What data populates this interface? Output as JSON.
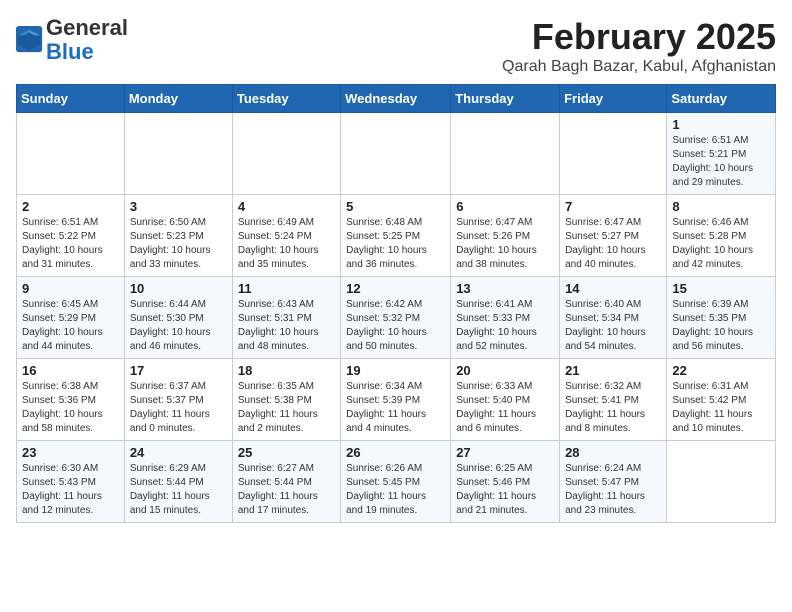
{
  "header": {
    "logo_line1": "General",
    "logo_line2": "Blue",
    "month_title": "February 2025",
    "location": "Qarah Bagh Bazar, Kabul, Afghanistan"
  },
  "days_of_week": [
    "Sunday",
    "Monday",
    "Tuesday",
    "Wednesday",
    "Thursday",
    "Friday",
    "Saturday"
  ],
  "weeks": [
    [
      {
        "day": "",
        "info": ""
      },
      {
        "day": "",
        "info": ""
      },
      {
        "day": "",
        "info": ""
      },
      {
        "day": "",
        "info": ""
      },
      {
        "day": "",
        "info": ""
      },
      {
        "day": "",
        "info": ""
      },
      {
        "day": "1",
        "info": "Sunrise: 6:51 AM\nSunset: 5:21 PM\nDaylight: 10 hours and 29 minutes."
      }
    ],
    [
      {
        "day": "2",
        "info": "Sunrise: 6:51 AM\nSunset: 5:22 PM\nDaylight: 10 hours and 31 minutes."
      },
      {
        "day": "3",
        "info": "Sunrise: 6:50 AM\nSunset: 5:23 PM\nDaylight: 10 hours and 33 minutes."
      },
      {
        "day": "4",
        "info": "Sunrise: 6:49 AM\nSunset: 5:24 PM\nDaylight: 10 hours and 35 minutes."
      },
      {
        "day": "5",
        "info": "Sunrise: 6:48 AM\nSunset: 5:25 PM\nDaylight: 10 hours and 36 minutes."
      },
      {
        "day": "6",
        "info": "Sunrise: 6:47 AM\nSunset: 5:26 PM\nDaylight: 10 hours and 38 minutes."
      },
      {
        "day": "7",
        "info": "Sunrise: 6:47 AM\nSunset: 5:27 PM\nDaylight: 10 hours and 40 minutes."
      },
      {
        "day": "8",
        "info": "Sunrise: 6:46 AM\nSunset: 5:28 PM\nDaylight: 10 hours and 42 minutes."
      }
    ],
    [
      {
        "day": "9",
        "info": "Sunrise: 6:45 AM\nSunset: 5:29 PM\nDaylight: 10 hours and 44 minutes."
      },
      {
        "day": "10",
        "info": "Sunrise: 6:44 AM\nSunset: 5:30 PM\nDaylight: 10 hours and 46 minutes."
      },
      {
        "day": "11",
        "info": "Sunrise: 6:43 AM\nSunset: 5:31 PM\nDaylight: 10 hours and 48 minutes."
      },
      {
        "day": "12",
        "info": "Sunrise: 6:42 AM\nSunset: 5:32 PM\nDaylight: 10 hours and 50 minutes."
      },
      {
        "day": "13",
        "info": "Sunrise: 6:41 AM\nSunset: 5:33 PM\nDaylight: 10 hours and 52 minutes."
      },
      {
        "day": "14",
        "info": "Sunrise: 6:40 AM\nSunset: 5:34 PM\nDaylight: 10 hours and 54 minutes."
      },
      {
        "day": "15",
        "info": "Sunrise: 6:39 AM\nSunset: 5:35 PM\nDaylight: 10 hours and 56 minutes."
      }
    ],
    [
      {
        "day": "16",
        "info": "Sunrise: 6:38 AM\nSunset: 5:36 PM\nDaylight: 10 hours and 58 minutes."
      },
      {
        "day": "17",
        "info": "Sunrise: 6:37 AM\nSunset: 5:37 PM\nDaylight: 11 hours and 0 minutes."
      },
      {
        "day": "18",
        "info": "Sunrise: 6:35 AM\nSunset: 5:38 PM\nDaylight: 11 hours and 2 minutes."
      },
      {
        "day": "19",
        "info": "Sunrise: 6:34 AM\nSunset: 5:39 PM\nDaylight: 11 hours and 4 minutes."
      },
      {
        "day": "20",
        "info": "Sunrise: 6:33 AM\nSunset: 5:40 PM\nDaylight: 11 hours and 6 minutes."
      },
      {
        "day": "21",
        "info": "Sunrise: 6:32 AM\nSunset: 5:41 PM\nDaylight: 11 hours and 8 minutes."
      },
      {
        "day": "22",
        "info": "Sunrise: 6:31 AM\nSunset: 5:42 PM\nDaylight: 11 hours and 10 minutes."
      }
    ],
    [
      {
        "day": "23",
        "info": "Sunrise: 6:30 AM\nSunset: 5:43 PM\nDaylight: 11 hours and 12 minutes."
      },
      {
        "day": "24",
        "info": "Sunrise: 6:29 AM\nSunset: 5:44 PM\nDaylight: 11 hours and 15 minutes."
      },
      {
        "day": "25",
        "info": "Sunrise: 6:27 AM\nSunset: 5:44 PM\nDaylight: 11 hours and 17 minutes."
      },
      {
        "day": "26",
        "info": "Sunrise: 6:26 AM\nSunset: 5:45 PM\nDaylight: 11 hours and 19 minutes."
      },
      {
        "day": "27",
        "info": "Sunrise: 6:25 AM\nSunset: 5:46 PM\nDaylight: 11 hours and 21 minutes."
      },
      {
        "day": "28",
        "info": "Sunrise: 6:24 AM\nSunset: 5:47 PM\nDaylight: 11 hours and 23 minutes."
      },
      {
        "day": "",
        "info": ""
      }
    ]
  ]
}
